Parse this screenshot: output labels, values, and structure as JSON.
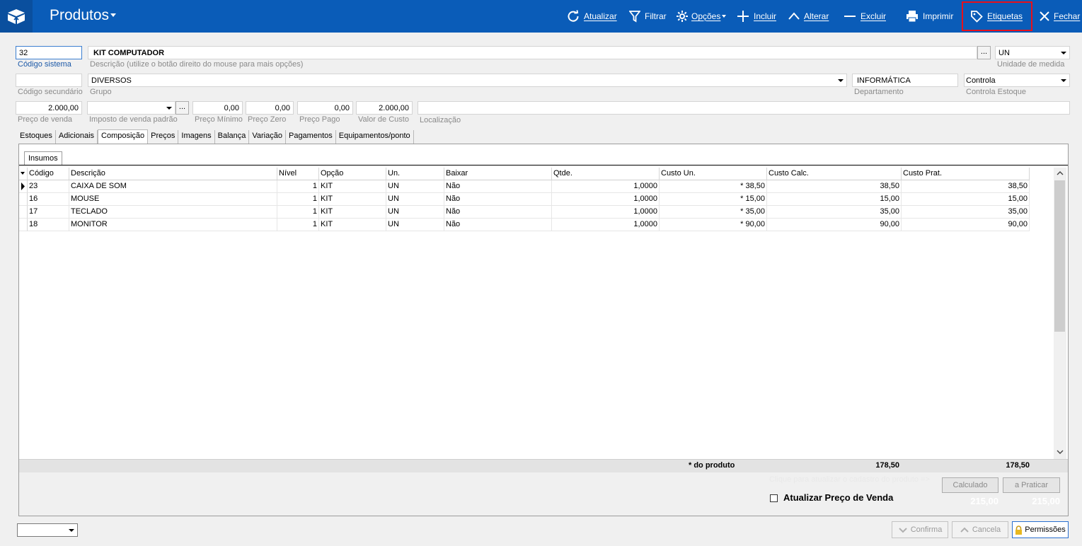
{
  "header": {
    "title": "Produtos",
    "accent_color": "#0a5cb8",
    "toolbar": [
      {
        "key": "atualizar",
        "label": "Atualizar",
        "icon": "refresh-icon"
      },
      {
        "key": "filtrar",
        "label": "Filtrar",
        "icon": "filter-icon"
      },
      {
        "key": "opcoes",
        "label": "Opções",
        "icon": "gear-icon"
      },
      {
        "key": "incluir",
        "label": "Incluir",
        "icon": "plus-icon"
      },
      {
        "key": "alterar",
        "label": "Alterar",
        "icon": "chevron-up-icon"
      },
      {
        "key": "excluir",
        "label": "Excluir",
        "icon": "minus-icon"
      },
      {
        "key": "imprimir",
        "label": "Imprimir",
        "icon": "printer-icon"
      },
      {
        "key": "etiquetas",
        "label": "Etiquetas",
        "icon": "tag-icon"
      },
      {
        "key": "fechar",
        "label": "Fechar",
        "icon": "close-icon"
      }
    ]
  },
  "form": {
    "codigo_sistema": {
      "value": "32",
      "label": "Código sistema"
    },
    "descricao": {
      "value": "KIT COMPUTADOR",
      "label": "Descrição (utilize o botão direito do mouse para mais opções)"
    },
    "unidade": {
      "value": "UN",
      "label": "Unidade de medida"
    },
    "codigo_secundario": {
      "value": "",
      "label": "Código secundário"
    },
    "grupo": {
      "value": "DIVERSOS",
      "label": "Grupo"
    },
    "departamento": {
      "value": "INFORMÁTICA",
      "label": "Departamento"
    },
    "controla_estoque": {
      "value": "Controla",
      "label": "Controla Estoque"
    },
    "preco_venda": {
      "value": "2.000,00",
      "label": "Preço de venda"
    },
    "imposto": {
      "value": "",
      "label": "Imposto de venda padrão"
    },
    "preco_minimo": {
      "value": "0,00",
      "label": "Preço Mínimo"
    },
    "preco_zero": {
      "value": "0,00",
      "label": "Preço Zero"
    },
    "preco_pago": {
      "value": "0,00",
      "label": "Preço Pago"
    },
    "valor_custo": {
      "value": "2.000,00",
      "label": "Valor de Custo"
    },
    "localizacao": {
      "value": "",
      "label": "Localização"
    },
    "ellipsis": "..."
  },
  "tabs": [
    "Estoques",
    "Adicionais",
    "Composição",
    "Preços",
    "Imagens",
    "Balança",
    "Variação",
    "Pagamentos",
    "Equipamentos/ponto"
  ],
  "active_tab": "Composição",
  "subtab": "Insumos",
  "grid": {
    "columns": [
      "Código",
      "Descrição",
      "Nível",
      "Opção",
      "Un.",
      "Baixar",
      "Qtde.",
      "Custo Un.",
      "Custo Calc.",
      "Custo Prat."
    ],
    "rows": [
      [
        "23",
        "CAIXA DE SOM",
        "1",
        "KIT",
        "UN",
        "Não",
        "1,0000",
        "* 38,50",
        "38,50",
        "38,50"
      ],
      [
        "16",
        "MOUSE",
        "1",
        "KIT",
        "UN",
        "Não",
        "1,0000",
        "* 15,00",
        "15,00",
        "15,00"
      ],
      [
        "17",
        "TECLADO",
        "1",
        "KIT",
        "UN",
        "Não",
        "1,0000",
        "* 35,00",
        "35,00",
        "35,00"
      ],
      [
        "18",
        "MONITOR",
        "1",
        "KIT",
        "UN",
        "Não",
        "1,0000",
        "* 90,00",
        "90,00",
        "90,00"
      ]
    ],
    "footer": {
      "label": "* do produto",
      "custo_calc": "178,50",
      "custo_prat": "178,50"
    }
  },
  "bottom_panel": {
    "hint": "Clique para atualizar o cadastro do produto =>",
    "calculado_button": "Calculado",
    "praticar_button": "a Praticar",
    "atualizar_checkbox": "Atualizar Preço de Venda",
    "atualizar_checked": false,
    "valor_calculado": "215,00",
    "valor_praticar": "215,00"
  },
  "footer": {
    "select_value": "",
    "confirma": "Confirma",
    "cancela": "Cancela",
    "permissoes": "Permissões"
  }
}
